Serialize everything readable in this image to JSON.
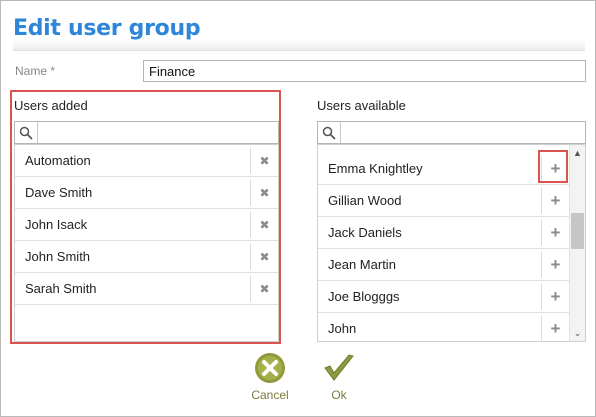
{
  "dialog": {
    "title": "Edit user group"
  },
  "name_field": {
    "label": "Name *",
    "value": "Finance"
  },
  "users_added": {
    "label": "Users added",
    "search_placeholder": "",
    "items": [
      "Automation",
      "Dave Smith",
      "John Isack",
      "John Smith",
      "Sarah Smith"
    ],
    "action_glyph": "✖",
    "action_icon": "close-icon"
  },
  "users_available": {
    "label": "Users available",
    "search_placeholder": "",
    "items": [
      "Emma Knightley",
      "Gillian Wood",
      "Jack Daniels",
      "Jean Martin",
      "Joe Blogggs",
      "John"
    ],
    "action_glyph": "+",
    "action_icon": "plus-icon"
  },
  "buttons": {
    "cancel": "Cancel",
    "ok": "Ok"
  },
  "colors": {
    "title": "#2f86d9",
    "highlight": "#d9534f",
    "cancel_icon": "#8f9a3d",
    "ok_icon": "#8f9a3d"
  }
}
